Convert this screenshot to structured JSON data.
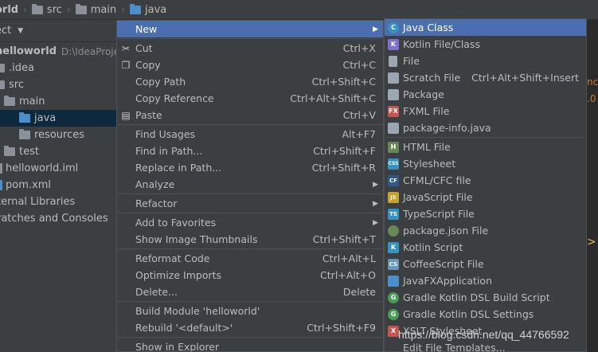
{
  "breadcrumb": [
    {
      "label": "orld",
      "icon": "project-icon"
    },
    {
      "label": "src",
      "icon": "folder-icon"
    },
    {
      "label": "main",
      "icon": "folder-icon"
    },
    {
      "label": "java",
      "icon": "source-folder-icon"
    }
  ],
  "project_panel": {
    "header": "ect",
    "tree": [
      {
        "label": "helloworld",
        "extra": "D:\\IdeaProjects",
        "icon": "module-folder-icon"
      },
      {
        "label": ".idea",
        "icon": "folder-icon"
      },
      {
        "label": "src",
        "icon": "folder-icon"
      },
      {
        "label": "main",
        "icon": "folder-icon"
      },
      {
        "label": "java",
        "icon": "source-folder-icon",
        "selected": true
      },
      {
        "label": "resources",
        "icon": "resources-folder-icon"
      },
      {
        "label": "test",
        "icon": "folder-icon"
      },
      {
        "label": "helloworld.iml",
        "icon": "iml-file-icon"
      },
      {
        "label": "pom.xml",
        "icon": "maven-file-icon"
      },
      {
        "label": "ternal Libraries",
        "icon": "library-icon"
      },
      {
        "label": "ratches and Consoles",
        "icon": "scratches-icon"
      }
    ]
  },
  "editor": {
    "glyphs": [
      "nc",
      ".0"
    ],
    "marker": ">"
  },
  "context_menu": {
    "items": [
      {
        "label": "New",
        "shortcut": "",
        "has_submenu": true,
        "active": true
      },
      {
        "label": "Cut",
        "shortcut": "Ctrl+X",
        "icon": "scissors-icon"
      },
      {
        "label": "Copy",
        "shortcut": "Ctrl+C",
        "icon": "copy-icon"
      },
      {
        "label": "Copy Path",
        "shortcut": "Ctrl+Shift+C"
      },
      {
        "label": "Copy Reference",
        "shortcut": "Ctrl+Alt+Shift+C"
      },
      {
        "label": "Paste",
        "shortcut": "Ctrl+V",
        "icon": "paste-icon"
      },
      {
        "label": "Find Usages",
        "shortcut": "Alt+F7"
      },
      {
        "label": "Find in Path...",
        "shortcut": "Ctrl+Shift+F"
      },
      {
        "label": "Replace in Path...",
        "shortcut": "Ctrl+Shift+R"
      },
      {
        "label": "Analyze",
        "shortcut": "",
        "has_submenu": true
      },
      {
        "label": "Refactor",
        "shortcut": "",
        "has_submenu": true
      },
      {
        "label": "Add to Favorites",
        "shortcut": "",
        "has_submenu": true
      },
      {
        "label": "Show Image Thumbnails",
        "shortcut": "Ctrl+Shift+T"
      },
      {
        "label": "Reformat Code",
        "shortcut": "Ctrl+Alt+L"
      },
      {
        "label": "Optimize Imports",
        "shortcut": "Ctrl+Alt+O"
      },
      {
        "label": "Delete...",
        "shortcut": "Delete"
      },
      {
        "label": "Build Module 'helloworld'",
        "shortcut": ""
      },
      {
        "label": "Rebuild '<default>'",
        "shortcut": "Ctrl+Shift+F9"
      },
      {
        "label": "Show in Explorer",
        "shortcut": ""
      }
    ]
  },
  "submenu": {
    "items": [
      {
        "label": "Java Class",
        "shortcut": "",
        "icon": "java-class-icon",
        "icon_text": "C",
        "color": "#3592c4",
        "active": true
      },
      {
        "label": "Kotlin File/Class",
        "shortcut": "",
        "icon": "kotlin-icon",
        "icon_text": "K",
        "color": "#7f6fd0"
      },
      {
        "label": "File",
        "shortcut": "",
        "icon": "file-icon",
        "icon_text": "",
        "color": "#9aa7b0"
      },
      {
        "label": "Scratch File",
        "shortcut": "Ctrl+Alt+Shift+Insert",
        "icon": "scratch-file-icon",
        "icon_text": "",
        "color": "#9aa7b0"
      },
      {
        "label": "Package",
        "shortcut": "",
        "icon": "package-icon",
        "icon_text": "",
        "color": "#9aa7b0"
      },
      {
        "label": "FXML File",
        "shortcut": "",
        "icon": "fxml-file-icon",
        "icon_text": "FX",
        "color": "#c75450"
      },
      {
        "label": "package-info.java",
        "shortcut": "",
        "icon": "package-info-icon",
        "icon_text": "",
        "color": "#9aa7b0"
      },
      {
        "label": "HTML File",
        "shortcut": "",
        "icon": "html-file-icon",
        "icon_text": "H",
        "color": "#6a8759"
      },
      {
        "label": "Stylesheet",
        "shortcut": "",
        "icon": "stylesheet-icon",
        "icon_text": "CSS",
        "color": "#3592c4"
      },
      {
        "label": "CFML/CFC file",
        "shortcut": "",
        "icon": "cfml-file-icon",
        "icon_text": "CF",
        "color": "#2d5a8b"
      },
      {
        "label": "JavaScript File",
        "shortcut": "",
        "icon": "javascript-file-icon",
        "icon_text": "JS",
        "color": "#c9a227"
      },
      {
        "label": "TypeScript File",
        "shortcut": "",
        "icon": "typescript-file-icon",
        "icon_text": "TS",
        "color": "#3592c4"
      },
      {
        "label": "package.json File",
        "shortcut": "",
        "icon": "npm-icon",
        "icon_text": "",
        "color": "#6a8759"
      },
      {
        "label": "Kotlin Script",
        "shortcut": "",
        "icon": "kotlin-script-icon",
        "icon_text": "K",
        "color": "#3592c4"
      },
      {
        "label": "CoffeeScript File",
        "shortcut": "",
        "icon": "coffeescript-icon",
        "icon_text": "CS",
        "color": "#6897bb"
      },
      {
        "label": "JavaFXApplication",
        "shortcut": "",
        "icon": "javafx-icon",
        "icon_text": "",
        "color": "#4a8fc9"
      },
      {
        "label": "Gradle Kotlin DSL Build Script",
        "shortcut": "",
        "icon": "gradle-icon",
        "icon_text": "G",
        "color": "#499c54"
      },
      {
        "label": "Gradle Kotlin DSL Settings",
        "shortcut": "",
        "icon": "gradle-settings-icon",
        "icon_text": "G",
        "color": "#499c54"
      },
      {
        "label": "XSLT Stylesheet",
        "shortcut": "",
        "icon": "xslt-icon",
        "icon_text": "X",
        "color": "#c75450"
      },
      {
        "label": "Edit File Templates...",
        "shortcut": "",
        "icon": "",
        "icon_text": "",
        "color": ""
      }
    ]
  },
  "watermark": "https://blog.csdn.net/qq_44766592",
  "colors": {
    "selection": "#4b6eaf",
    "menu_bg": "#3c3f41",
    "tree_selection": "#0d293e"
  }
}
